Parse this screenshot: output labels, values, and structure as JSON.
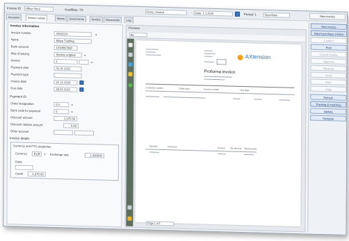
{
  "topbar": {
    "customer_label": "Invoice ID",
    "customer_value": "Office Ferry",
    "filter_label": "AvailBlue: TS",
    "dropdown_value": "Ferry | Invoice",
    "date_label": "Date: 1.1.2020",
    "extra_label": "Period: 1",
    "extra_value": "Sync/New",
    "new_button": "New invoice"
  },
  "tabs": [
    {
      "label": "Accounts"
    },
    {
      "label": "Invoice values"
    },
    {
      "label": "Memo"
    },
    {
      "label": "Event items"
    },
    {
      "label": "Invoice"
    },
    {
      "label": "Documents"
    },
    {
      "label": "Log"
    }
  ],
  "form": {
    "section_title": "Invoice information",
    "fields": [
      {
        "label": "Invoice number",
        "value": "2050224"
      },
      {
        "label": "Name",
        "value": "Maya Tveiting"
      },
      {
        "label": "Bank account",
        "value": "1234567890"
      },
      {
        "label": "Way of paying",
        "value": "Invoice original"
      },
      {
        "label": "Invoice",
        "value": "1"
      },
      {
        "label": "Payment date",
        "value": "01.01.2021"
      },
      {
        "label": "Payment type",
        "value": ""
      },
      {
        "label": "Invoice date",
        "value": "31.12.2020"
      },
      {
        "label": "Due date",
        "value": "28.01.2021"
      }
    ],
    "extra_title": "Payment ID",
    "extra_fields": [
      {
        "label": "Order designation",
        "value": "0.1"
      },
      {
        "label": "Bank code for payment",
        "value": "0"
      },
      {
        "label": "Discount amount",
        "value": "1,375.00"
      },
      {
        "label": "Discount relative amount",
        "value": "0.00"
      },
      {
        "label": "Other account",
        "value": ""
      }
    ],
    "invoice_details_title": "Invoice details",
    "currency_group_title": "Currency and FTC properties",
    "currency_label": "Currency",
    "currency_value": "EUR",
    "exchange_label": "Exchange rate",
    "exchange_value": "1.000000",
    "debit_label": "Debit",
    "credit_label": "Credit",
    "credit_value": "1,375.00"
  },
  "preview": {
    "title": "Preview",
    "zoom": "Fit",
    "logo_text": "AXtension",
    "doc_title": "Proforma invoice",
    "page_indicator": "Page 1 of 1",
    "lines": [
      "Customer number",
      "Order date",
      "Invoice number",
      "Due date",
      "Quantity",
      "Unit price",
      "Amount",
      "Tax amount",
      "Total amount"
    ]
  },
  "actions": [
    {
      "label": "New invoice",
      "state": "top"
    },
    {
      "label": "Import purchase invoice",
      "state": "top"
    },
    {
      "label": "Confirm",
      "state": "off"
    },
    {
      "label": "Post",
      "state": "on"
    },
    {
      "label": "Cancel invoice",
      "state": "off"
    },
    {
      "label": "Approve",
      "state": "off"
    },
    {
      "label": "Reverse",
      "state": "off"
    },
    {
      "label": "Send",
      "state": "off"
    },
    {
      "label": "Print",
      "state": "off"
    },
    {
      "label": "Copy",
      "state": "off"
    },
    {
      "label": "Refresh",
      "state": "on"
    },
    {
      "label": "Tracking & matching",
      "state": "top"
    },
    {
      "label": "Update",
      "state": "on"
    },
    {
      "label": "Navigate",
      "state": "on"
    }
  ],
  "colors": {
    "accent": "#3f74b8",
    "logo_orange": "#f3a21b",
    "toolbar_green": "#5d6e5e"
  }
}
